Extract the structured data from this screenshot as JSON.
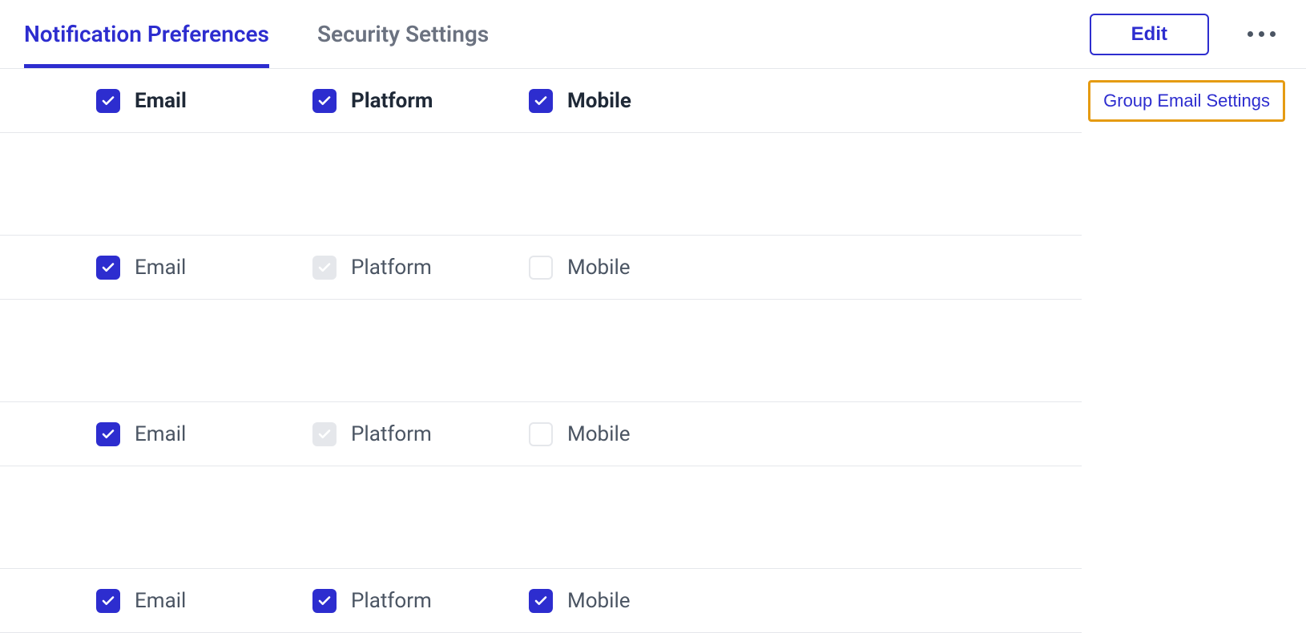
{
  "header": {
    "tabs": [
      {
        "label": "Notification Preferences",
        "active": true
      },
      {
        "label": "Security Settings",
        "active": false
      }
    ],
    "edit_label": "Edit",
    "group_email_label": "Group Email Settings"
  },
  "channels": {
    "email": "Email",
    "platform": "Platform",
    "mobile": "Mobile"
  },
  "rows": [
    {
      "email": "checked",
      "platform": "checked",
      "mobile": "checked",
      "bold": true
    },
    {
      "email": "checked",
      "platform": "disabled-checked",
      "mobile": "unchecked",
      "bold": false
    },
    {
      "email": "checked",
      "platform": "disabled-checked",
      "mobile": "unchecked",
      "bold": false
    },
    {
      "email": "checked",
      "platform": "checked",
      "mobile": "checked",
      "bold": false
    }
  ]
}
